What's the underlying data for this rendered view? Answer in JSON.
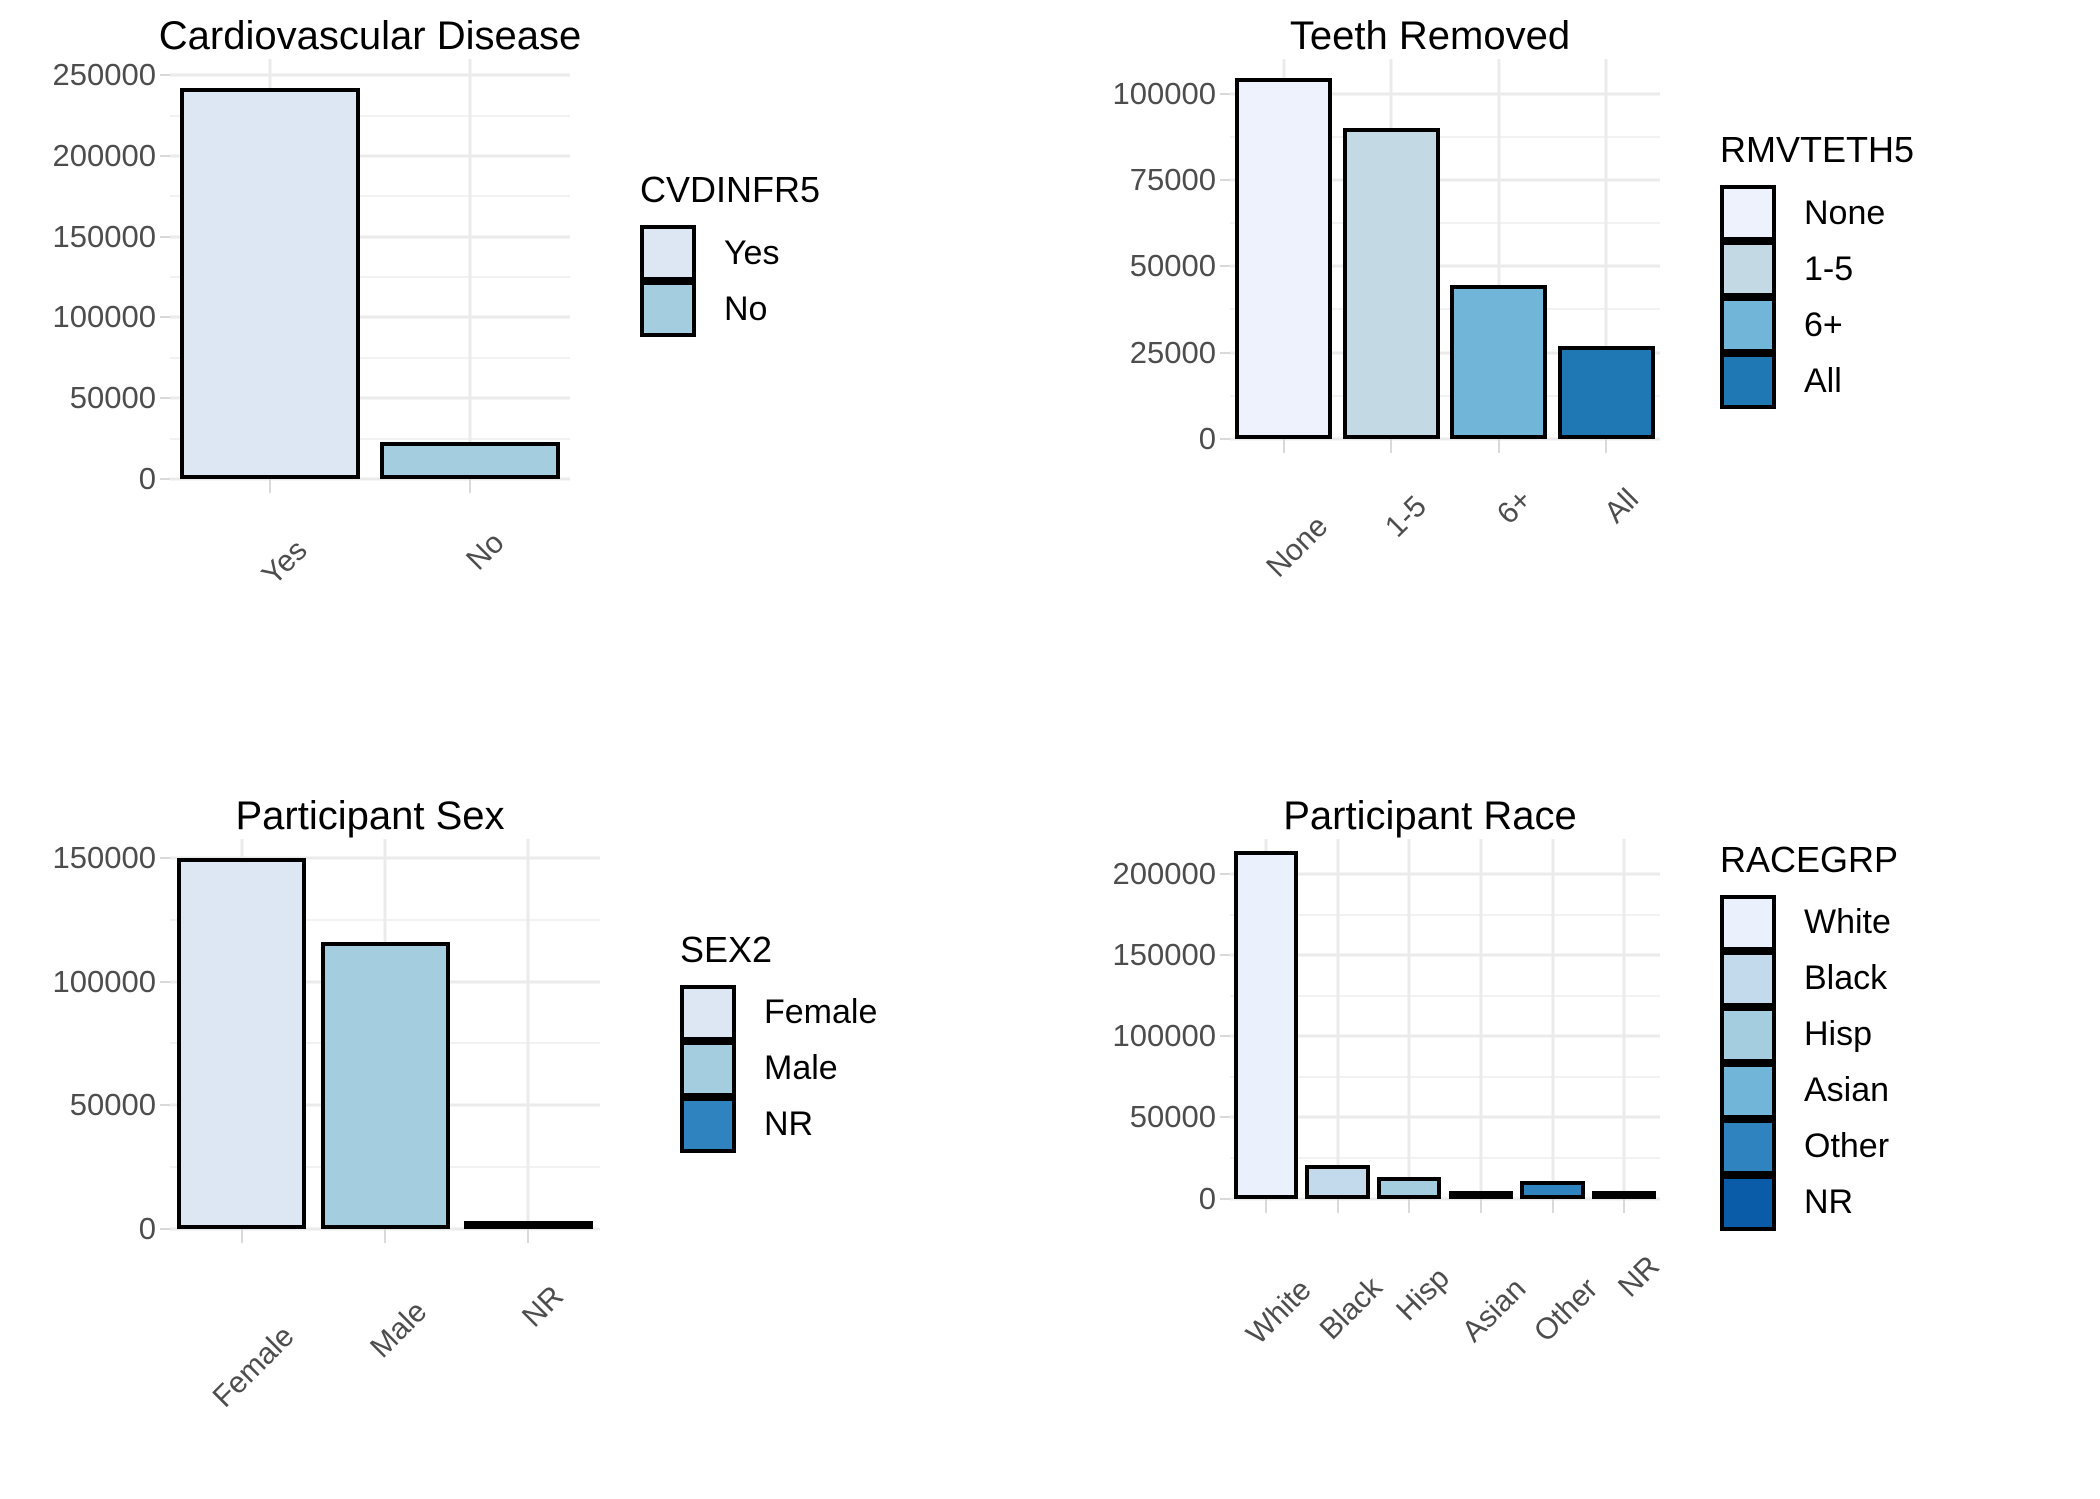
{
  "figure": {
    "background": "#ffffff",
    "bar_outline_color": "#000000",
    "gridline_color": "#ebebeb",
    "axis_text_color": "#4d4d4d"
  },
  "panels": [
    {
      "id": "cardiovascular-disease",
      "title": "Cardiovascular Disease",
      "legend_title": "CVDINFR5"
    },
    {
      "id": "teeth-removed",
      "title": "Teeth Removed",
      "legend_title": "RMVTETH5"
    },
    {
      "id": "participant-sex",
      "title": "Participant Sex",
      "legend_title": "SEX2"
    },
    {
      "id": "participant-race",
      "title": "Participant Race",
      "legend_title": "RACEGRP"
    }
  ],
  "chart_data": [
    {
      "type": "bar",
      "title": "Cardiovascular Disease",
      "xlabel": "",
      "ylabel": "",
      "legend_title": "CVDINFR5",
      "legend_position": "right",
      "grid": true,
      "categories": [
        "Yes",
        "No"
      ],
      "values": [
        242000,
        23000
      ],
      "colors": [
        "#dce7f3",
        "#a4cee0"
      ],
      "ylim": [
        0,
        260000
      ],
      "yticks": [
        0,
        50000,
        100000,
        150000,
        200000,
        250000
      ],
      "ytick_labels": [
        "0",
        "50000",
        "100000",
        "150000",
        "200000",
        "250000"
      ],
      "legend_entries": [
        {
          "label": "Yes",
          "color": "#dce7f3"
        },
        {
          "label": "No",
          "color": "#a4cee0"
        }
      ]
    },
    {
      "type": "bar",
      "title": "Teeth Removed",
      "xlabel": "",
      "ylabel": "",
      "legend_title": "RMVTETH5",
      "legend_position": "right",
      "grid": true,
      "categories": [
        "None",
        "1-5",
        "6+",
        "All"
      ],
      "values": [
        104500,
        90000,
        44500,
        27000
      ],
      "colors": [
        "#eef2fc",
        "#c3d9e4",
        "#71b5d8",
        "#1f77b4"
      ],
      "ylim": [
        0,
        110000
      ],
      "yticks": [
        0,
        25000,
        50000,
        75000,
        100000
      ],
      "ytick_labels": [
        "0",
        "25000",
        "50000",
        "75000",
        "100000"
      ],
      "legend_entries": [
        {
          "label": "None",
          "color": "#eef2fc"
        },
        {
          "label": "1-5",
          "color": "#c3d9e4"
        },
        {
          "label": "6+",
          "color": "#71b5d8"
        },
        {
          "label": "All",
          "color": "#1f77b4"
        }
      ]
    },
    {
      "type": "bar",
      "title": "Participant Sex",
      "xlabel": "",
      "ylabel": "",
      "legend_title": "SEX2",
      "legend_position": "right",
      "grid": true,
      "categories": [
        "Female",
        "Male",
        "NR"
      ],
      "values": [
        150000,
        116000,
        700
      ],
      "colors": [
        "#dce7f3",
        "#a4cee0",
        "#2f83bf"
      ],
      "ylim": [
        0,
        158000
      ],
      "yticks": [
        0,
        50000,
        100000,
        150000
      ],
      "ytick_labels": [
        "0",
        "50000",
        "100000",
        "150000"
      ],
      "legend_entries": [
        {
          "label": "Female",
          "color": "#dce7f3"
        },
        {
          "label": "Male",
          "color": "#a4cee0"
        },
        {
          "label": "NR",
          "color": "#2f83bf"
        }
      ]
    },
    {
      "type": "bar",
      "title": "Participant Race",
      "xlabel": "",
      "ylabel": "",
      "legend_title": "RACEGRP",
      "legend_position": "right",
      "grid": true,
      "categories": [
        "White",
        "Black",
        "Hisp",
        "Asian",
        "Other",
        "NR"
      ],
      "values": [
        214000,
        20500,
        13500,
        3000,
        10500,
        2500
      ],
      "colors": [
        "#eaf0fc",
        "#c3d9ec",
        "#a4cee0",
        "#71b5d8",
        "#2f83bf",
        "#0b5ca8"
      ],
      "ylim": [
        0,
        222000
      ],
      "yticks": [
        0,
        50000,
        100000,
        150000,
        200000
      ],
      "ytick_labels": [
        "0",
        "50000",
        "100000",
        "150000",
        "200000"
      ],
      "legend_entries": [
        {
          "label": "White",
          "color": "#eaf0fc"
        },
        {
          "label": "Black",
          "color": "#c3d9ec"
        },
        {
          "label": "Hisp",
          "color": "#a4cee0"
        },
        {
          "label": "Asian",
          "color": "#71b5d8"
        },
        {
          "label": "Other",
          "color": "#2f83bf"
        },
        {
          "label": "NR",
          "color": "#0b5ca8"
        }
      ]
    }
  ]
}
